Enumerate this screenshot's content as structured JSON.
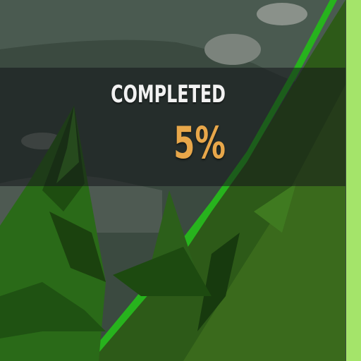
{
  "progress": {
    "label": "COMPLETED",
    "value_text": "5%",
    "value_percent": 5
  },
  "colors": {
    "label": "#f2f2f2",
    "value": "#e8a74a",
    "edge_bar": "#a4e46a",
    "foliage_dark": "#1f4a14",
    "foliage_mid": "#2f6a1c",
    "foliage_bright": "#28b01e"
  }
}
